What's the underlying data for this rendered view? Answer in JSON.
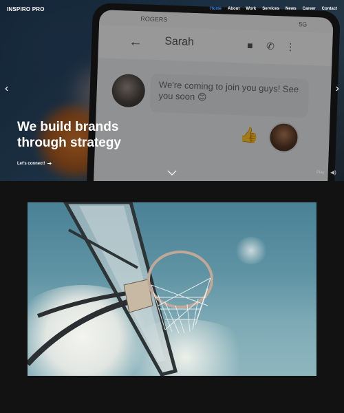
{
  "brand": {
    "logo": "INSPIRO PRO"
  },
  "nav": {
    "items": [
      {
        "label": "Home",
        "active": true
      },
      {
        "label": "About",
        "active": false
      },
      {
        "label": "Work",
        "active": false
      },
      {
        "label": "Services",
        "active": false
      },
      {
        "label": "News",
        "active": false
      },
      {
        "label": "Career",
        "active": false
      },
      {
        "label": "Contact",
        "active": false
      }
    ]
  },
  "hero": {
    "headline_line1": "We build brands",
    "headline_line2": "through strategy",
    "cta_label": "Let's connect!",
    "play_label": "Play",
    "icons": {
      "prev": "chevron-left-icon",
      "next": "chevron-right-icon",
      "scroll": "chevron-down-icon",
      "sound": "speaker-icon",
      "cta": "arrow-right-icon"
    },
    "phone": {
      "carrier": "ROGERS",
      "network": "5G",
      "contact_name": "Sarah",
      "message": "We're coming to join you guys! See you soon 😊",
      "reply_emoji": "👍"
    }
  },
  "colors": {
    "accent": "#3d8ef0",
    "dark_bg": "#121212",
    "text": "#ffffff"
  }
}
